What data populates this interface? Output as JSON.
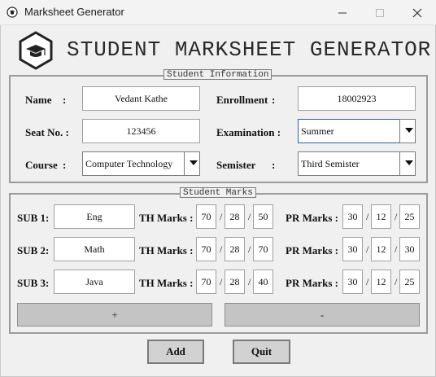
{
  "window": {
    "title": "Marksheet Generator"
  },
  "header": {
    "title": "STUDENT MARKSHEET GENERATOR",
    "logo_icon": "graduation-cap-icon"
  },
  "student_info": {
    "legend": "Student Information",
    "name_label": "Name",
    "name_value": "Vedant Kathe",
    "enrollment_label": "Enrollment",
    "enrollment_value": "18002923",
    "seat_label": "Seat No. :",
    "seat_value": "123456",
    "exam_label": "Examination :",
    "exam_value": "Summer",
    "course_label": "Course",
    "course_value": "Computer Technology",
    "semester_label": "Semister",
    "semester_value": "Third Semister",
    "colon": ":"
  },
  "marks": {
    "legend": "Student Marks",
    "th_label": "TH Marks :",
    "pr_label": "PR Marks :",
    "slash": "/",
    "subjects": [
      {
        "label": "SUB 1:",
        "name": "Eng",
        "th": [
          "70",
          "28",
          "50"
        ],
        "pr": [
          "30",
          "12",
          "25"
        ]
      },
      {
        "label": "SUB 2:",
        "name": "Math",
        "th": [
          "70",
          "28",
          "70"
        ],
        "pr": [
          "30",
          "12",
          "30"
        ]
      },
      {
        "label": "SUB 3:",
        "name": "Java",
        "th": [
          "70",
          "28",
          "40"
        ],
        "pr": [
          "30",
          "12",
          "25"
        ]
      }
    ],
    "add_row_label": "+",
    "remove_row_label": "-"
  },
  "actions": {
    "add_label": "Add",
    "quit_label": "Quit"
  }
}
